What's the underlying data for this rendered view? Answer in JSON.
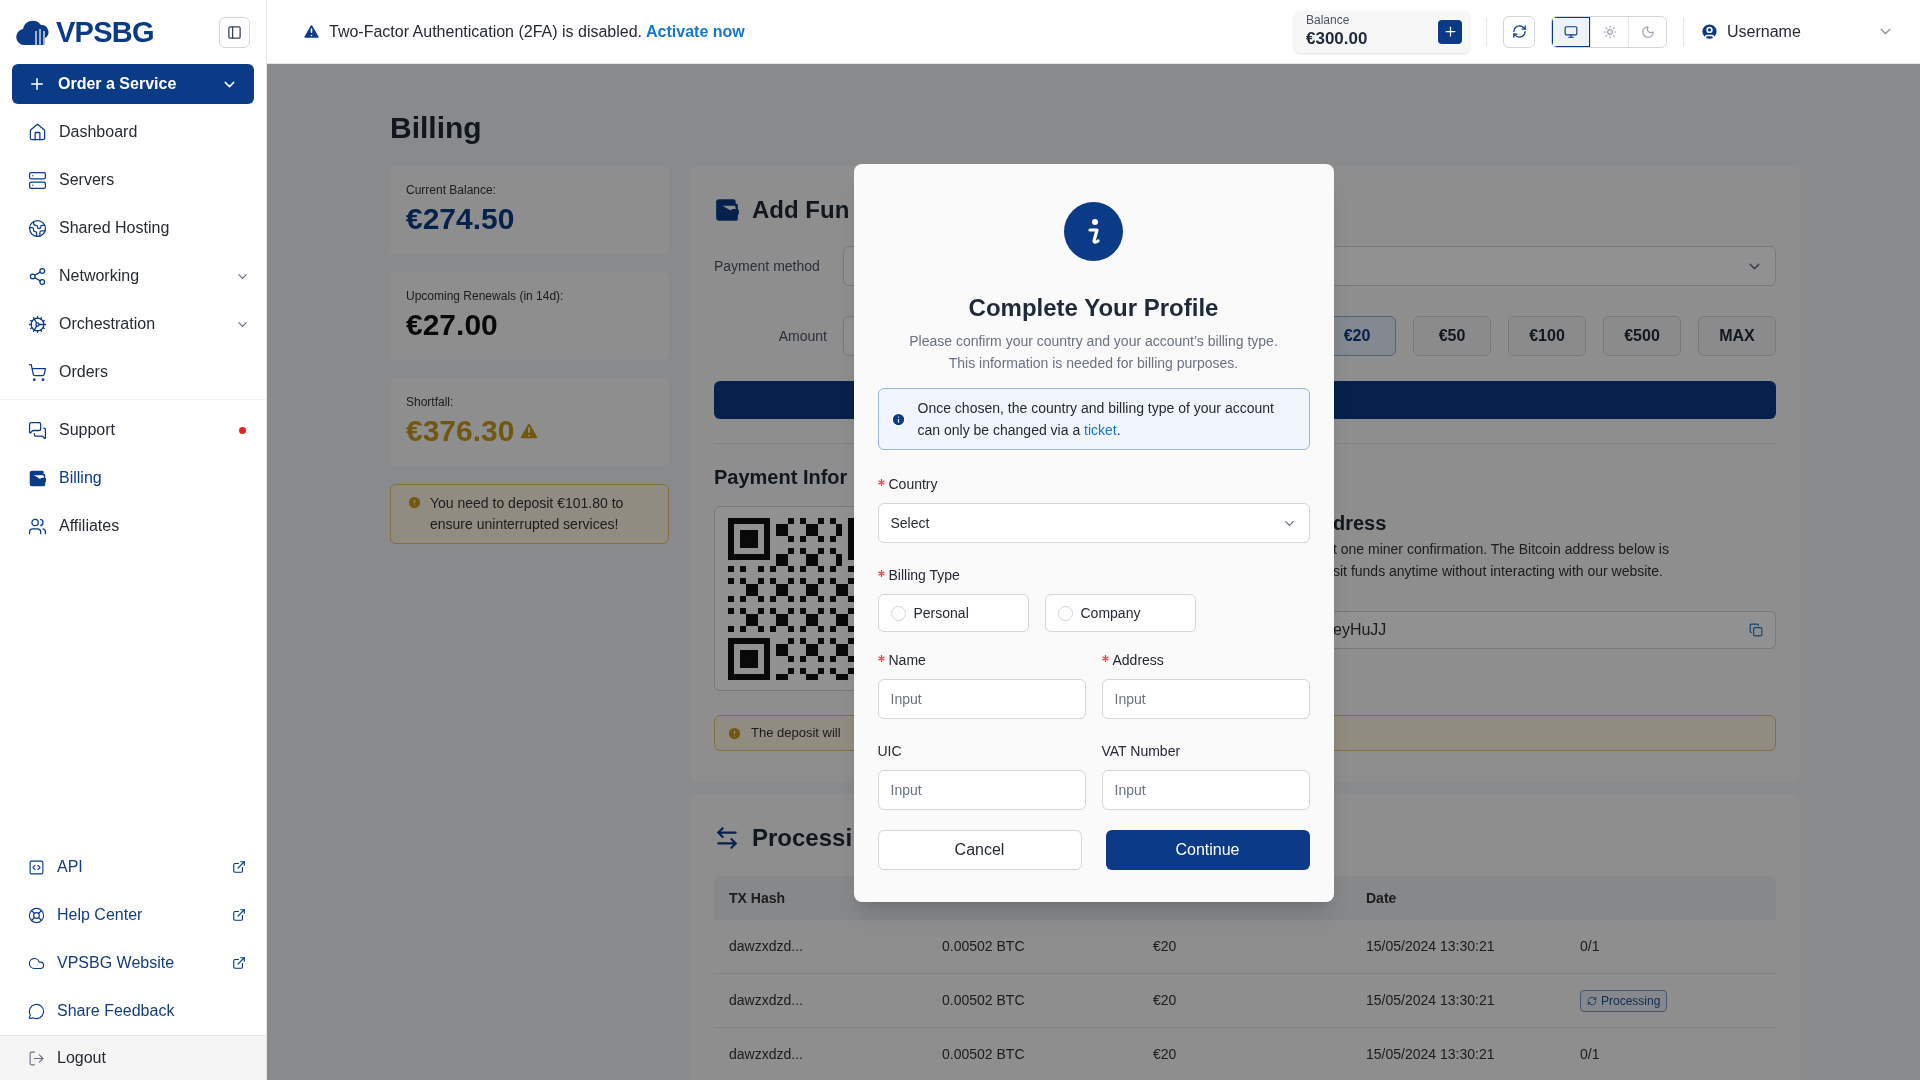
{
  "logo": {
    "text": "VPSBG"
  },
  "sidebar": {
    "order_button": {
      "label": "Order a Service"
    },
    "main_items": [
      {
        "label": "Dashboard",
        "selected": false,
        "expandable": false,
        "notification": false
      },
      {
        "label": "Servers",
        "selected": false,
        "expandable": false,
        "notification": false
      },
      {
        "label": "Shared Hosting",
        "selected": false,
        "expandable": false,
        "notification": false
      },
      {
        "label": "Networking",
        "selected": false,
        "expandable": true,
        "notification": false
      },
      {
        "label": "Orchestration",
        "selected": false,
        "expandable": true,
        "notification": false
      },
      {
        "label": "Orders",
        "selected": false,
        "expandable": false,
        "notification": false
      }
    ],
    "secondary_items": [
      {
        "label": "Support",
        "selected": false,
        "expandable": false,
        "notification": true
      },
      {
        "label": "Billing",
        "selected": true,
        "expandable": false,
        "notification": false
      },
      {
        "label": "Affiliates",
        "selected": false,
        "expandable": false,
        "notification": false
      }
    ],
    "footer_items": [
      {
        "label": "API",
        "kind": "link",
        "external": true
      },
      {
        "label": "Help Center",
        "kind": "link",
        "external": true
      },
      {
        "label": "VPSBG Website",
        "kind": "link",
        "external": true
      },
      {
        "label": "Share Feedback",
        "kind": "link",
        "external": false
      },
      {
        "label": "Logout",
        "kind": "logout",
        "external": false
      }
    ]
  },
  "topbar": {
    "alert": {
      "text": "Two-Factor Authentication (2FA) is disabled.",
      "link": "Activate now"
    },
    "balance": {
      "label": "Balance",
      "amount": "€300.00"
    },
    "theme_modes": [
      {
        "selected": true
      },
      {
        "selected": false
      },
      {
        "selected": false
      }
    ],
    "user": {
      "name": "Username"
    }
  },
  "page": {
    "title": "Billing",
    "summary_cards": [
      {
        "label": "Current Balance:",
        "value": "€274.50",
        "kind": "balance"
      },
      {
        "label": "Upcoming Renewals (in 14d):",
        "value": "€27.00",
        "kind": "neutral"
      },
      {
        "label": "Shortfall:",
        "value": "€376.30",
        "kind": "warning"
      }
    ],
    "deposit_warning": "You need to deposit €101.80 to ensure uninterrupted services!",
    "add_funds": {
      "title": "Add Fun",
      "payment_method_label": "Payment method",
      "amount_label": "Amount",
      "amount_options": [
        {
          "label": "€20",
          "selected": true
        },
        {
          "label": "€50",
          "selected": false
        },
        {
          "label": "€100",
          "selected": false
        },
        {
          "label": "€500",
          "selected": false
        },
        {
          "label": "MAX",
          "selected": false
        }
      ]
    },
    "payment_info": {
      "title": "Payment Infor",
      "address_title": "dress",
      "description_lines": [
        "t one miner confirmation. The Bitcoin address below is",
        "sit funds anytime without interacting with our website."
      ],
      "address_value": "eyHuJJ",
      "notice": "The deposit will"
    },
    "processing": {
      "title": "Processi",
      "header": {
        "column_1": "TX Hash",
        "column_4": "Date"
      },
      "rows": [
        {
          "cells": [
            "dawzxdzd...",
            "0.00502 BTC",
            "€20",
            "15/05/2024 13:30:21"
          ],
          "status": {
            "kind": "text",
            "text": "0/1"
          }
        },
        {
          "cells": [
            "dawzxdzd...",
            "0.00502 BTC",
            "€20",
            "15/05/2024 13:30:21"
          ],
          "status": {
            "kind": "badge",
            "text": "Processing"
          }
        },
        {
          "cells": [
            "dawzxdzd...",
            "0.00502 BTC",
            "€20",
            "15/05/2024 13:30:21"
          ],
          "status": {
            "kind": "text",
            "text": "0/1"
          }
        }
      ]
    }
  },
  "modal": {
    "title": "Complete Your Profile",
    "description": "Please confirm your country and your account’s billing type.\nThis information is needed for billing purposes.",
    "notice": {
      "before": "Once chosen, the country and billing type of your account can only be changed via a ",
      "link": "ticket",
      "after": "."
    },
    "country": {
      "label": "Country",
      "required": true,
      "placeholder": "Select"
    },
    "billing_type": {
      "label": "Billing Type",
      "required": true,
      "options": [
        {
          "label": "Personal",
          "selected": false
        },
        {
          "label": "Company",
          "selected": false
        }
      ]
    },
    "fields": [
      {
        "label": "Name",
        "required": true,
        "placeholder": "Input"
      },
      {
        "label": "Address",
        "required": true,
        "placeholder": "Input"
      },
      {
        "label": "UIC",
        "required": false,
        "placeholder": "Input"
      },
      {
        "label": "VAT Number",
        "required": false,
        "placeholder": "Input"
      }
    ],
    "buttons": [
      {
        "label": "Cancel",
        "kind": "secondary"
      },
      {
        "label": "Continue",
        "kind": "primary"
      }
    ]
  }
}
